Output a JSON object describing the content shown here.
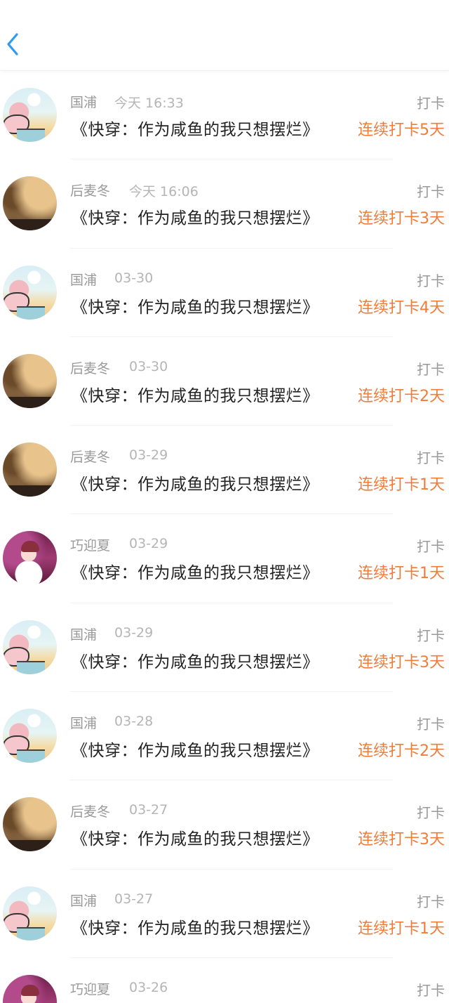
{
  "header": {
    "back_icon": "chevron-left-icon",
    "accent_color": "#2f9bf0"
  },
  "records": [
    {
      "avatar": "cartoon",
      "name": "国浦",
      "time": "今天 16:33",
      "action": "打卡",
      "book": "《快穿：作为咸鱼的我只想摆烂》",
      "streak": "连续打卡5天"
    },
    {
      "avatar": "autumn",
      "name": "后麦冬",
      "time": "今天 16:06",
      "action": "打卡",
      "book": "《快穿：作为咸鱼的我只想摆烂》",
      "streak": "连续打卡3天"
    },
    {
      "avatar": "cartoon",
      "name": "国浦",
      "time": "03-30",
      "action": "打卡",
      "book": "《快穿：作为咸鱼的我只想摆烂》",
      "streak": "连续打卡4天"
    },
    {
      "avatar": "autumn",
      "name": "后麦冬",
      "time": "03-30",
      "action": "打卡",
      "book": "《快穿：作为咸鱼的我只想摆烂》",
      "streak": "连续打卡2天"
    },
    {
      "avatar": "autumn",
      "name": "后麦冬",
      "time": "03-29",
      "action": "打卡",
      "book": "《快穿：作为咸鱼的我只想摆烂》",
      "streak": "连续打卡1天"
    },
    {
      "avatar": "portrait",
      "name": "巧迎夏",
      "time": "03-29",
      "action": "打卡",
      "book": "《快穿：作为咸鱼的我只想摆烂》",
      "streak": "连续打卡1天"
    },
    {
      "avatar": "cartoon",
      "name": "国浦",
      "time": "03-29",
      "action": "打卡",
      "book": "《快穿：作为咸鱼的我只想摆烂》",
      "streak": "连续打卡3天"
    },
    {
      "avatar": "cartoon",
      "name": "国浦",
      "time": "03-28",
      "action": "打卡",
      "book": "《快穿：作为咸鱼的我只想摆烂》",
      "streak": "连续打卡2天"
    },
    {
      "avatar": "autumn",
      "name": "后麦冬",
      "time": "03-27",
      "action": "打卡",
      "book": "《快穿：作为咸鱼的我只想摆烂》",
      "streak": "连续打卡3天"
    },
    {
      "avatar": "cartoon",
      "name": "国浦",
      "time": "03-27",
      "action": "打卡",
      "book": "《快穿：作为咸鱼的我只想摆烂》",
      "streak": "连续打卡1天"
    },
    {
      "avatar": "portrait",
      "name": "巧迎夏",
      "time": "03-26",
      "action": "打卡",
      "book": "",
      "streak": ""
    }
  ],
  "colors": {
    "streak": "#f07c3a",
    "name": "#999999",
    "book": "#222222"
  }
}
